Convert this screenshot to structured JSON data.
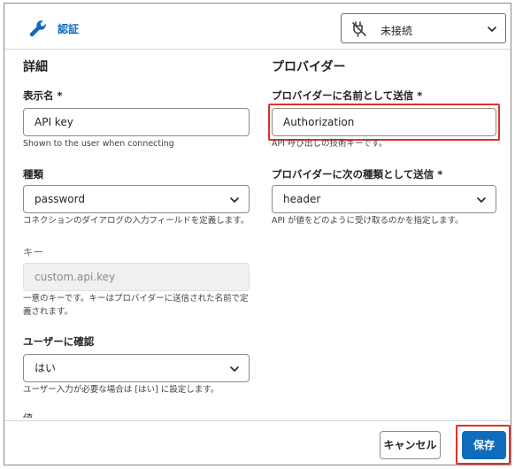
{
  "header": {
    "title": "認証",
    "connection_status": "未接続"
  },
  "left": {
    "heading": "詳細",
    "display_name": {
      "label": "表示名 *",
      "value": "API key",
      "help": "Shown to the user when connecting"
    },
    "type": {
      "label": "種類",
      "value": "password",
      "help": "コネクションのダイアログの入力フィールドを定義します。"
    },
    "key": {
      "label": "キー",
      "value": "custom.api.key",
      "help_line1": "一意のキーです。キーはプロバイダーに送信された名前で定",
      "help_line2": "義されます。"
    },
    "confirm": {
      "label": "ユーザーに確認",
      "value": "はい",
      "help": "ユーザー入力が必要な場合は [はい] に設定します。"
    },
    "next_label_partial": "値"
  },
  "right": {
    "heading": "プロバイダー",
    "send_name": {
      "label": "プロバイダーに名前として送信 *",
      "value": "Authorization",
      "help": "API 呼び出しの技術キーです。"
    },
    "send_type": {
      "label": "プロバイダーに次の種類として送信 *",
      "value": "header",
      "help": "API が値をどのように受け取るのかを指定します。"
    }
  },
  "footer": {
    "cancel_label": "キャンセル",
    "save_label": "保存"
  },
  "colors": {
    "accent": "#0f6cbd",
    "highlight": "#e0302b"
  }
}
